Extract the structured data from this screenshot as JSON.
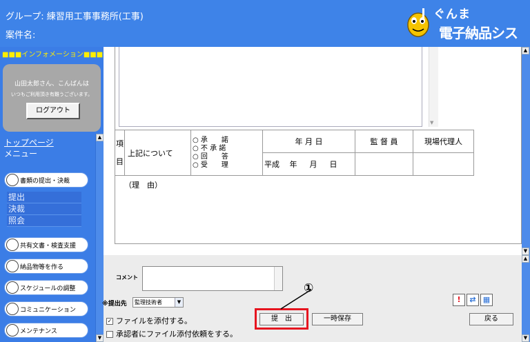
{
  "header": {
    "group_line": "グループ: 練習用工事事務所(工事)",
    "case_line": "案件名:",
    "logo_top": "ぐんま",
    "logo_bottom": "電子納品システム"
  },
  "sidebar": {
    "info_bar": "■■■インフォメーション■■■",
    "user_name": "山田太郎さん、こんばんは",
    "user_msg": "いつもご利用頂き有難うございます。",
    "logout_label": "ログアウト",
    "top_page": "トップページ",
    "menu": "メニュー",
    "pills": [
      "書類の提出・決裁",
      "共有文書・検査支援",
      "納品物等を作る",
      "スケジュールの調整",
      "コミュニケーション",
      "メンテナンス"
    ],
    "sub_items": [
      "提出",
      "決裁",
      "照会"
    ]
  },
  "form": {
    "item_label": "項目",
    "regarding": "上記について",
    "options": [
      "○ 承　　諾",
      "○ 不 承 諾",
      "○ 回　　答",
      "○ 受　　理"
    ],
    "date_header": "年 月 日",
    "supervisor": "監 督 員",
    "site_agent": "現場代理人",
    "date_value": "平成　 年 　 月 　 日",
    "reason": "（理　由）"
  },
  "bottom": {
    "comment_label": "コメント",
    "dest_label": "※提出先",
    "dest_value": "監理技術者",
    "attach_label": "ファイルを添付する。",
    "request_label": "承認者にファイル添付依頼をする。",
    "submit_label": "提　出",
    "temp_save_label": "一時保存",
    "back_label": "戻る",
    "callout": "①"
  },
  "colors": {
    "header_bg": "#3e83e8",
    "highlight": "#e6141f"
  }
}
